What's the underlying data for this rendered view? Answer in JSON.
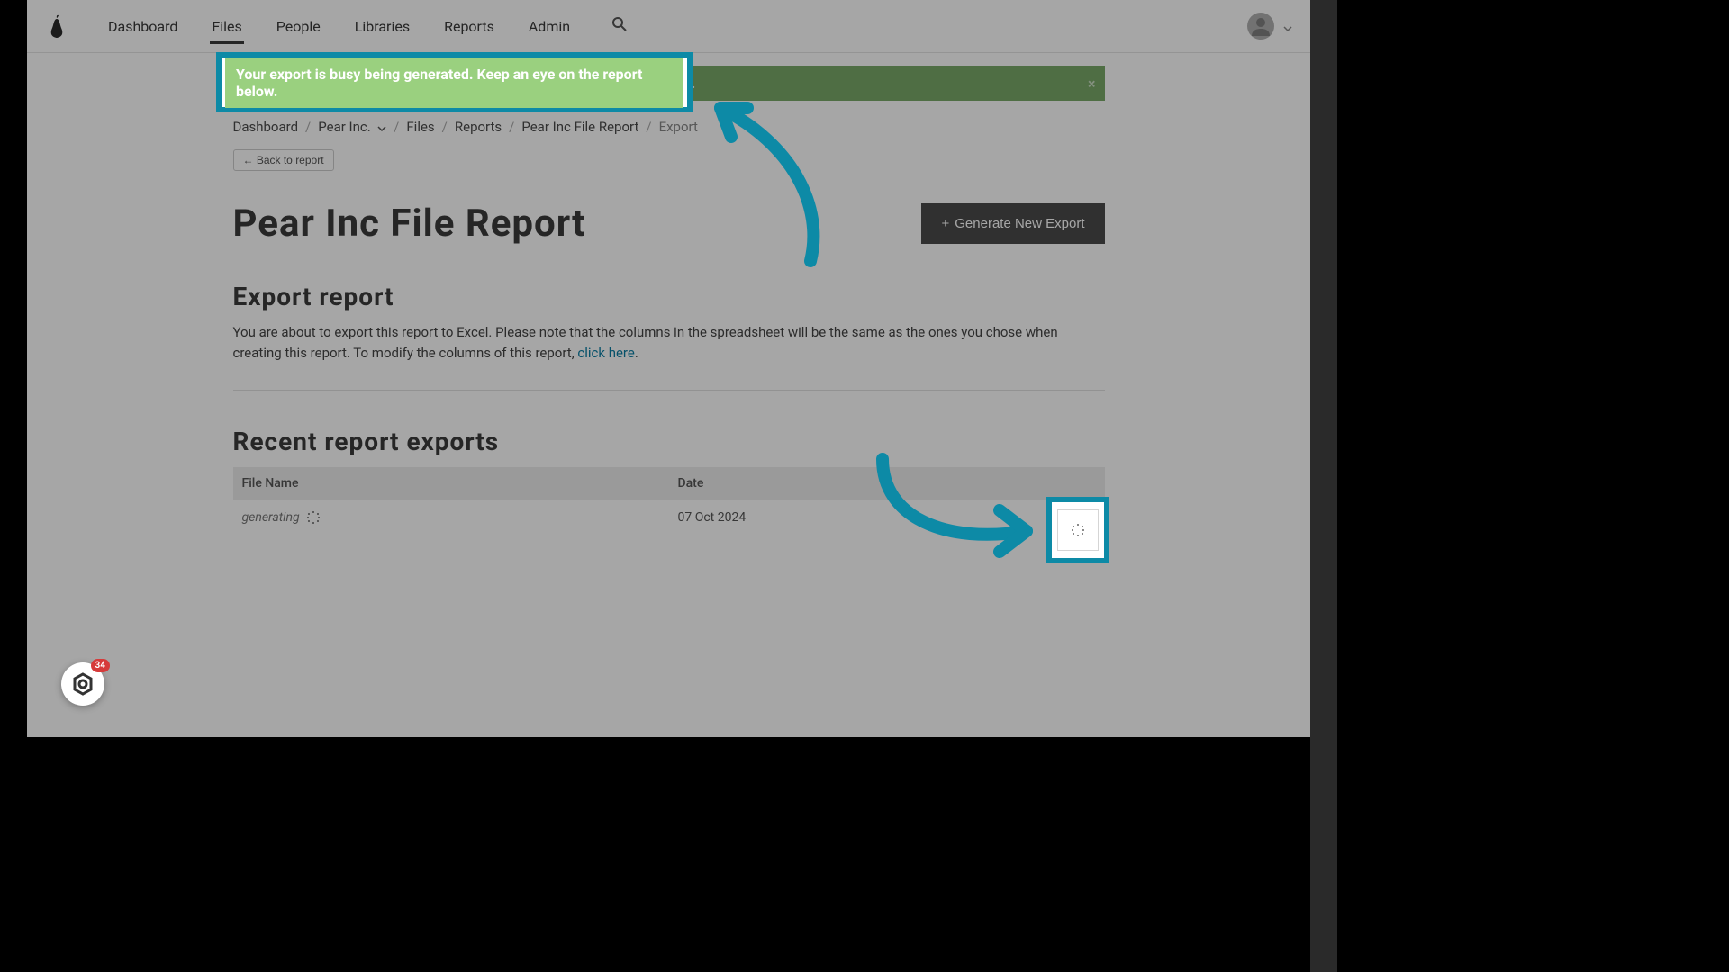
{
  "nav": {
    "items": [
      "Dashboard",
      "Files",
      "People",
      "Libraries",
      "Reports",
      "Admin"
    ],
    "active_index": 1
  },
  "alert": {
    "text": "Your export is busy being generated. Keep an eye on the report below.",
    "close": "×"
  },
  "breadcrumb": {
    "items": [
      {
        "label": "Dashboard"
      },
      {
        "label": "Pear Inc.",
        "dropdown": true
      },
      {
        "label": "Files"
      },
      {
        "label": "Reports"
      },
      {
        "label": "Pear Inc File Report"
      },
      {
        "label": "Export",
        "current": true
      }
    ]
  },
  "back_btn": "← Back to report",
  "page_title": "Pear Inc File Report",
  "generate_btn": {
    "plus": "+",
    "label": "Generate New Export"
  },
  "export_section": {
    "title": "Export report",
    "text_before": "You are about to export this report to Excel. Please note that the columns in the spreadsheet will be the same as the ones you chose when creating this report. To modify the columns of this report, ",
    "link": "click here",
    "text_after": "."
  },
  "recent_section": {
    "title": "Recent report exports",
    "columns": [
      "File Name",
      "Date",
      ""
    ],
    "rows": [
      {
        "filename": "generating",
        "date": "07 Oct 2024",
        "status": "loading"
      }
    ]
  },
  "widget_badge": "34"
}
